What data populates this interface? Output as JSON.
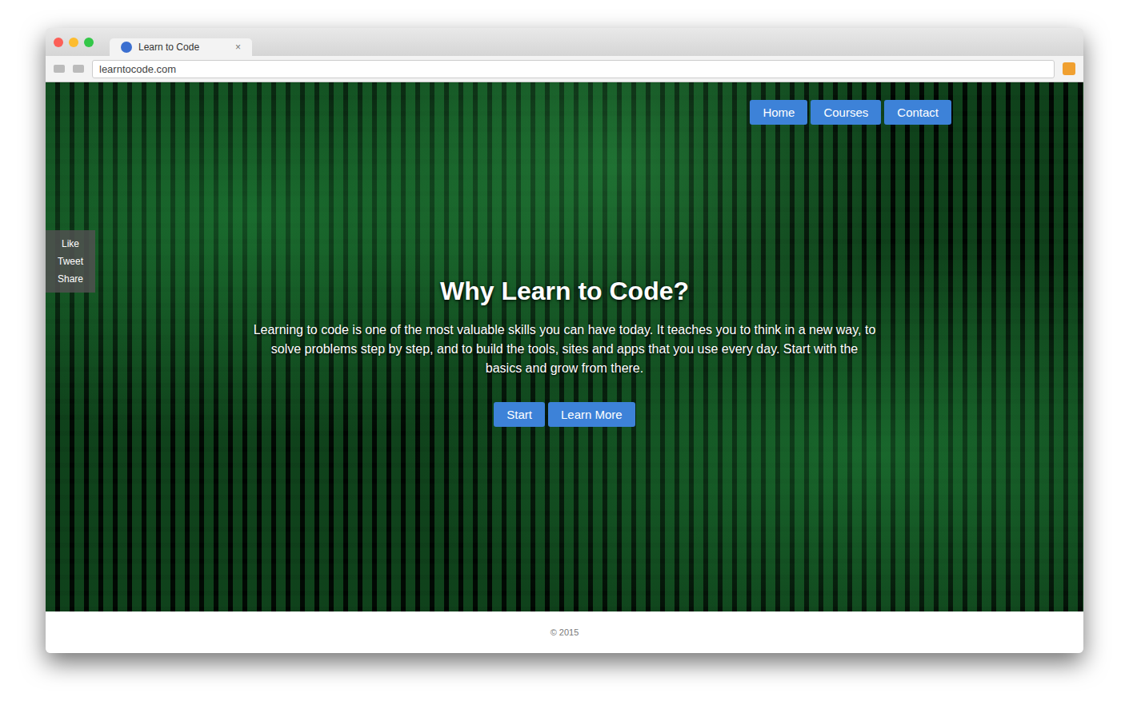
{
  "window": {
    "title": "Learn to Code",
    "address": "learntocode.com",
    "tab_close": "×"
  },
  "nav": [
    {
      "label": "Home",
      "selected": false
    },
    {
      "label": "Courses",
      "selected": false
    },
    {
      "label": "Contact",
      "selected": false
    }
  ],
  "sidebar": {
    "items": [
      "Like",
      "Tweet",
      "Share"
    ]
  },
  "hero": {
    "title": "Why Learn to Code?",
    "text": "Learning to code is one of the most valuable skills you can have today. It teaches you to think in a new way, to solve problems step by step, and to build the tools, sites and apps that you use every day. Start with the basics and grow from there.",
    "buttons": [
      "Start",
      "Learn More"
    ]
  },
  "footer": "© 2015"
}
